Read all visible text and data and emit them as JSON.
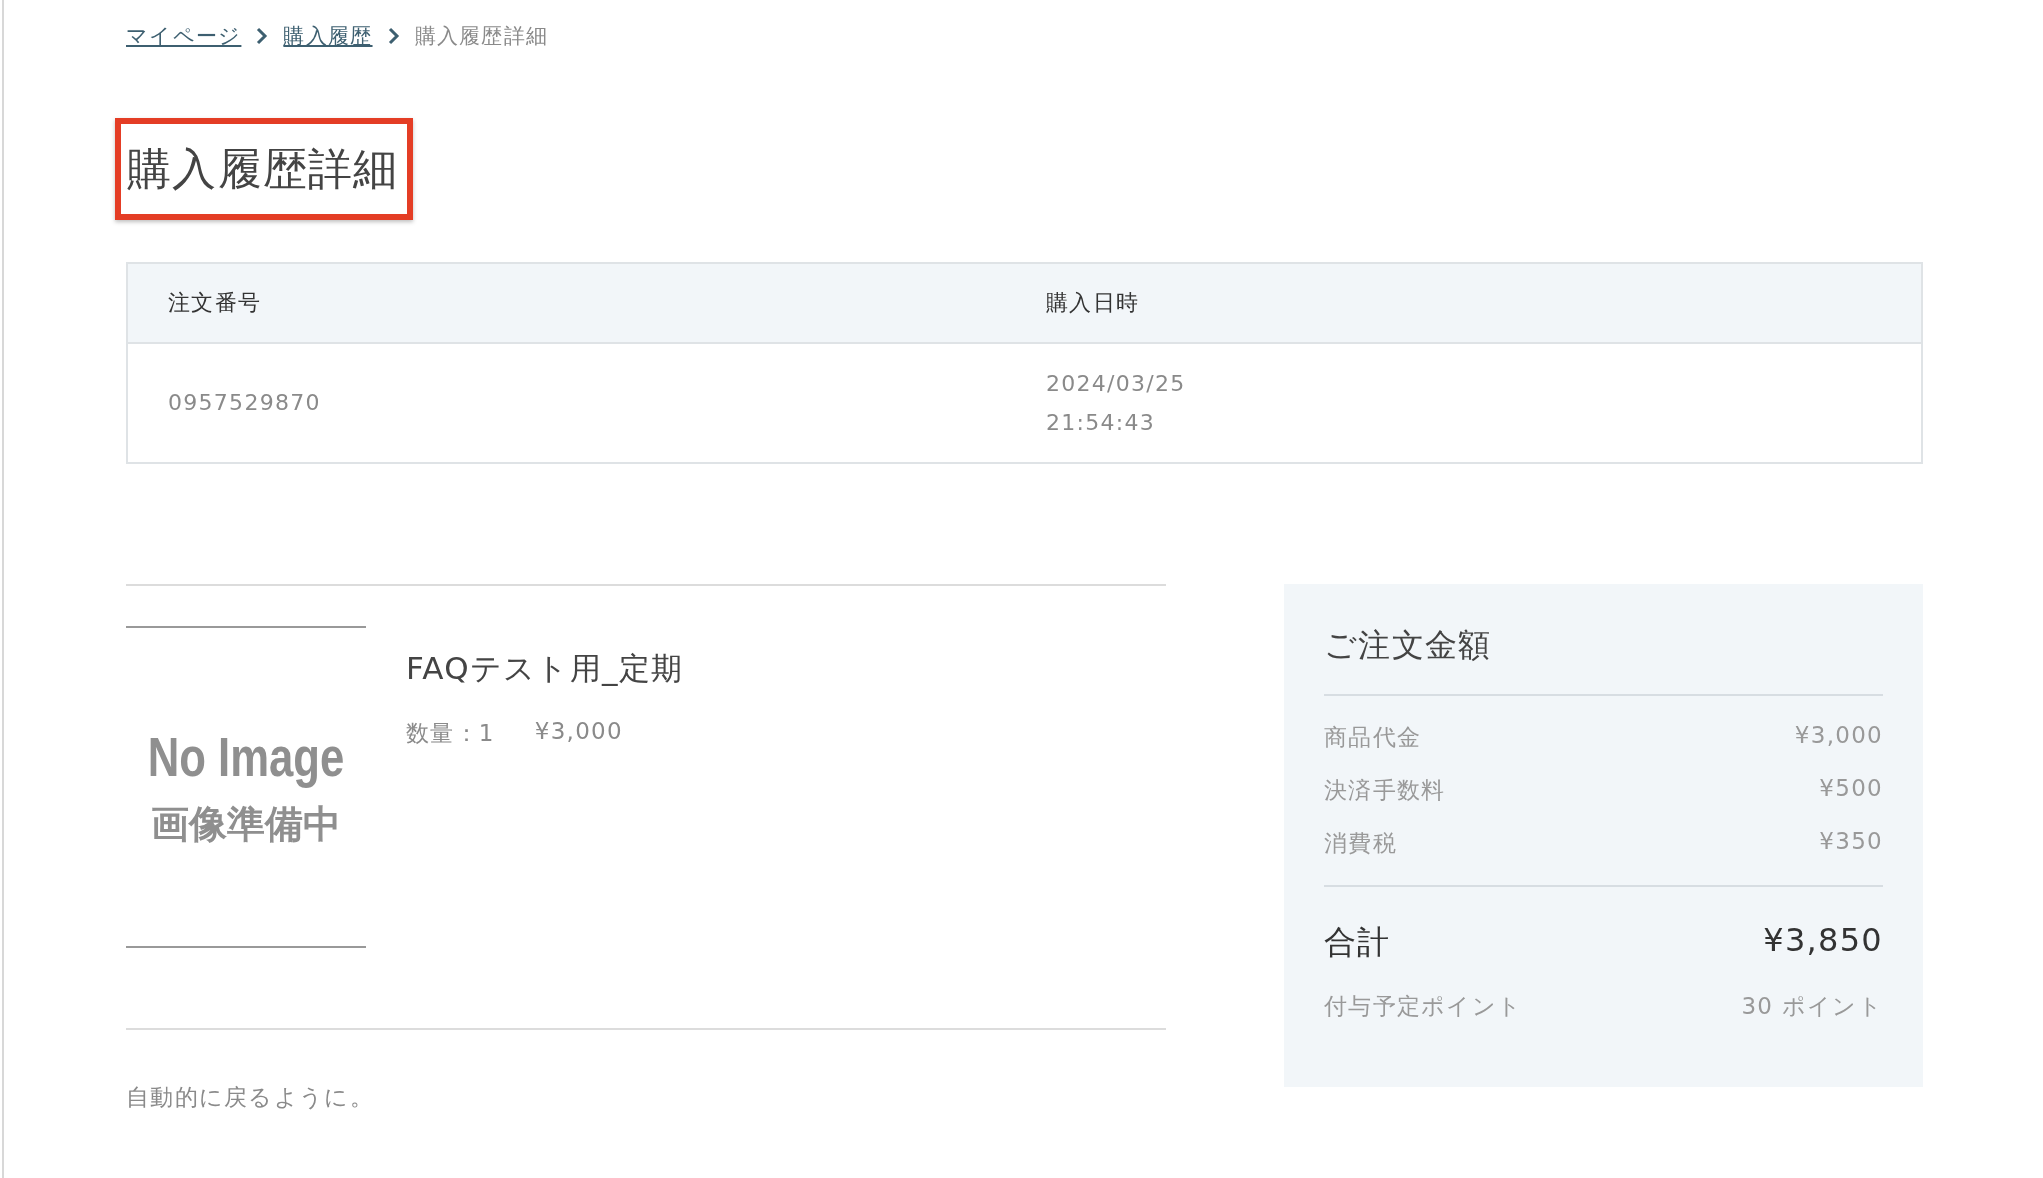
{
  "breadcrumb": [
    {
      "label": "マイページ",
      "link": true
    },
    {
      "label": "購入履歴",
      "link": true
    },
    {
      "label": "購入履歴詳細",
      "link": false
    }
  ],
  "title": {
    "text": "購入履歴詳細",
    "highlighted": true
  },
  "order_table": {
    "columns": [
      "注文番号",
      "購入日時"
    ],
    "row": {
      "order_number": "0957529870",
      "date": "2024/03/25",
      "time": "21:54:43"
    }
  },
  "item": {
    "image": {
      "label": "No Image",
      "caption": "画像準備中"
    },
    "name": "FAQテスト用_定期",
    "quantity": "数量：1",
    "price": "¥3,000"
  },
  "note": "自動的に戻るように。",
  "summary": {
    "title": "ご注文金額",
    "lines": [
      {
        "label": "商品代金",
        "value": "¥3,000"
      },
      {
        "label": "決済手数料",
        "value": "¥500"
      },
      {
        "label": "消費税",
        "value": "¥350"
      }
    ],
    "total": {
      "label": "合計",
      "value": "¥3,850"
    },
    "points": {
      "label": "付与予定ポイント",
      "value": "30 ポイント"
    }
  }
}
